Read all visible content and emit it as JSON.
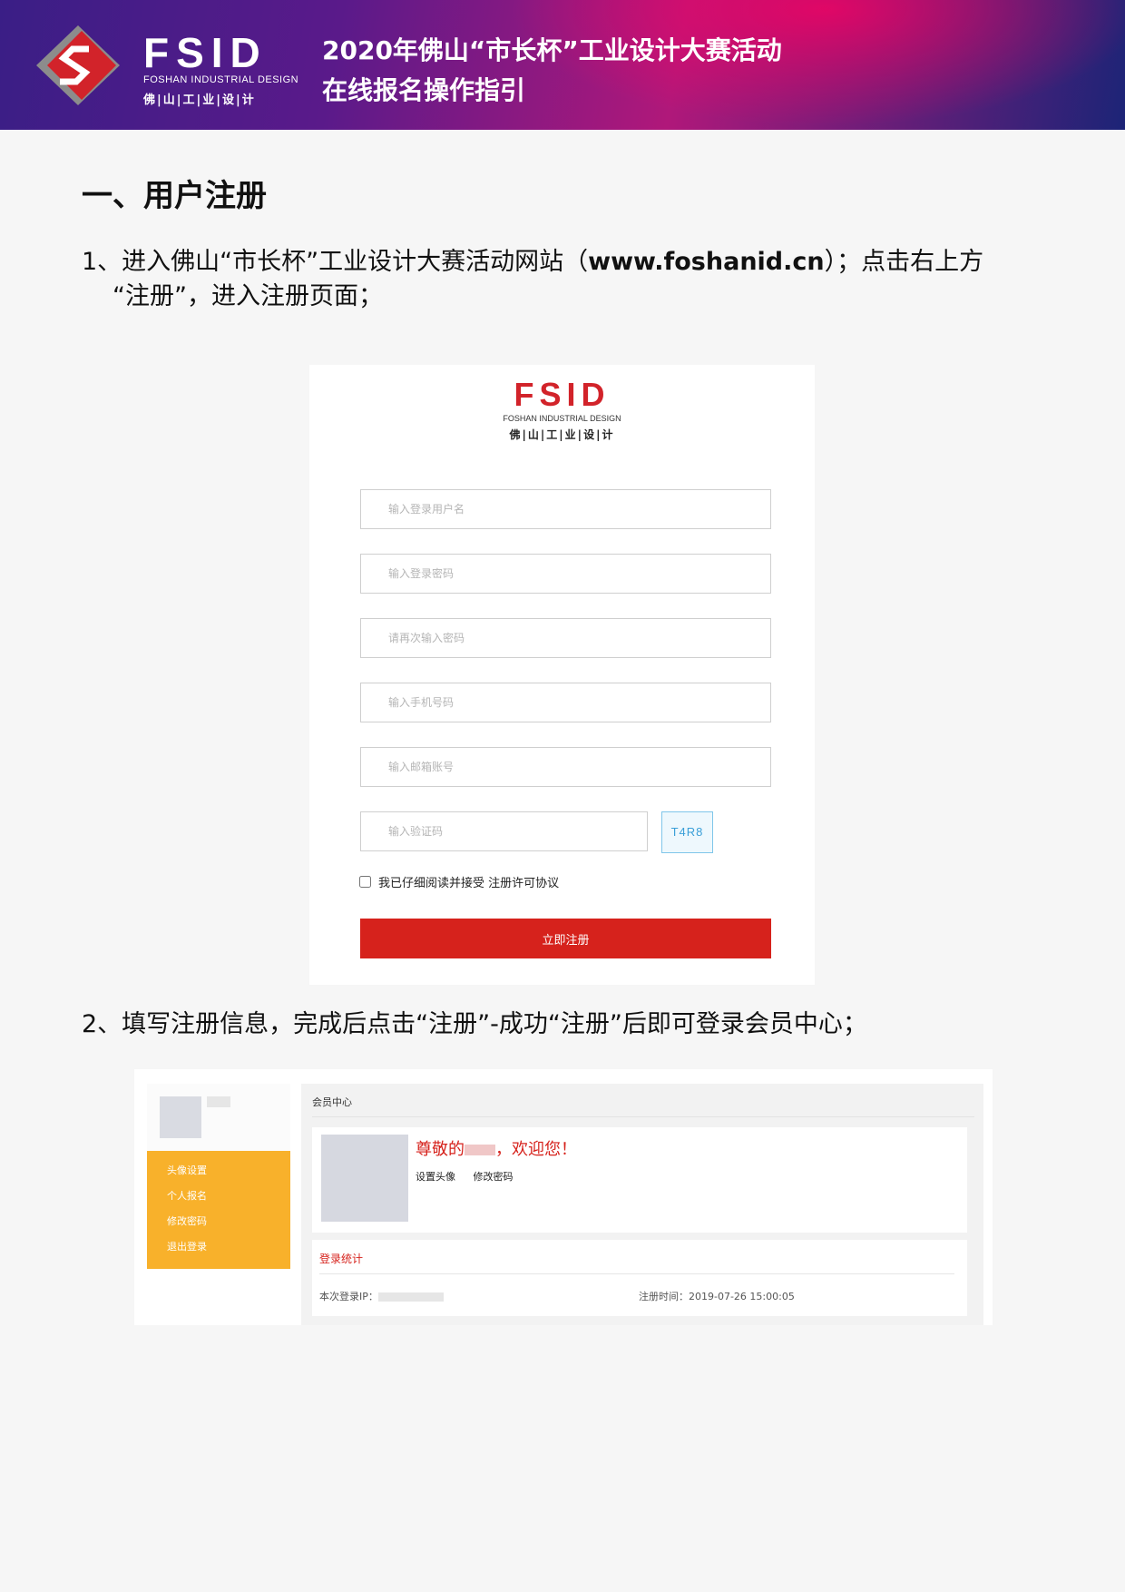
{
  "header": {
    "brand_word": "FSID",
    "brand_en": "FOSHAN INDUSTRIAL DESIGN",
    "brand_cn": "佛|山|工|业|设|计",
    "title_line1": "2020年佛山“市长杯”工业设计大赛活动",
    "title_line2": "在线报名操作指引"
  },
  "section_title": "一、用户注册",
  "step1": {
    "prefix": "1、进入佛山“市长杯”工业设计大赛活动网站（",
    "url": "www.foshanid.cn",
    "suffix": "）；点击右上方",
    "line2": "“注册”，进入注册页面；"
  },
  "register_form": {
    "logo_word": "FSID",
    "logo_en": "FOSHAN INDUSTRIAL DESIGN",
    "logo_cn": "佛|山|工|业|设|计",
    "username_placeholder": "输入登录用户名",
    "password_placeholder": "输入登录密码",
    "confirm_placeholder": "请再次输入密码",
    "phone_placeholder": "输入手机号码",
    "email_placeholder": "输入邮箱账号",
    "captcha_placeholder": "输入验证码",
    "captcha_text": "T4R8",
    "agree_label": "我已仔细阅读并接受 注册许可协议",
    "submit_label": "立即注册"
  },
  "step2": "2、填写注册信息，完成后点击“注册”-成功“注册”后即可登录会员中心；",
  "member_center": {
    "menu": [
      "头像设置",
      "个人报名",
      "修改密码",
      "退出登录"
    ],
    "breadcrumb": "会员中心",
    "greeting_prefix": "尊敬的",
    "greeting_suffix": "，欢迎您！",
    "link_avatar": "设置头像",
    "link_password": "修改密码",
    "stats_title": "登录统计",
    "ip_label": "本次登录IP：",
    "reg_time": "注册时间：2019-07-26 15:00:05"
  }
}
